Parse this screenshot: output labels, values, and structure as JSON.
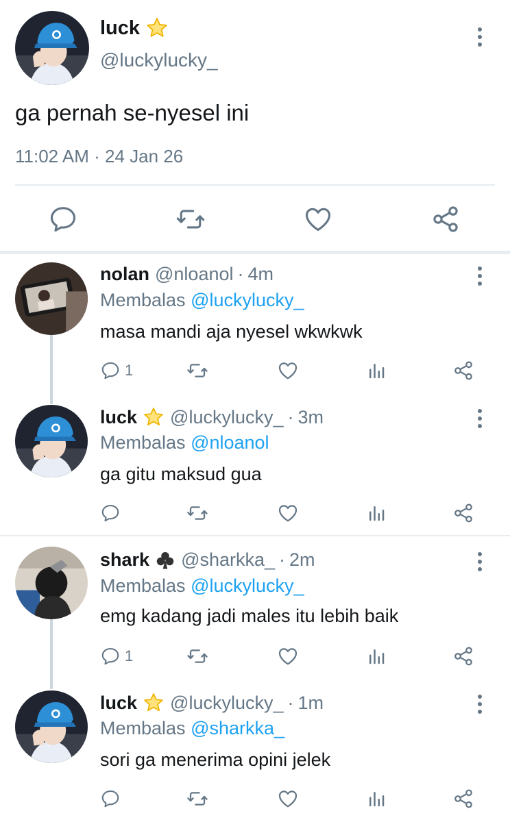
{
  "main_tweet": {
    "name": "luck",
    "badge_icon": "star-icon",
    "handle": "@luckylucky_",
    "text": "ga pernah se-nyesel ini",
    "timestamp": "11:02 AM · 24 Jan 26"
  },
  "replies": [
    {
      "name": "nolan",
      "handle": "@nloanol",
      "time": "4m",
      "replying_label": "Membalas",
      "replying_to": "@luckylucky_",
      "text": "masa mandi aja nyesel wkwkwk",
      "reply_count": "1"
    },
    {
      "name": "luck",
      "badge_icon": "star-icon",
      "handle": "@luckylucky_",
      "time": "3m",
      "replying_label": "Membalas",
      "replying_to": "@nloanol",
      "text": "ga gitu maksud gua",
      "reply_count": ""
    },
    {
      "name": "shark",
      "badge_icon": "club-icon",
      "handle": "@sharkka_",
      "time": "2m",
      "replying_label": "Membalas",
      "replying_to": "@luckylucky_",
      "text": "emg kadang jadi males itu lebih baik",
      "reply_count": "1"
    },
    {
      "name": "luck",
      "badge_icon": "star-icon",
      "handle": "@luckylucky_",
      "time": "1m",
      "replying_label": "Membalas",
      "replying_to": "@sharkka_",
      "text": "sori ga menerima opini jelek",
      "reply_count": ""
    }
  ],
  "colors": {
    "text": "#14171a",
    "secondary": "#657786",
    "mention": "#1da1f2",
    "divider": "#e6ecf0",
    "star": "#f5c518"
  }
}
